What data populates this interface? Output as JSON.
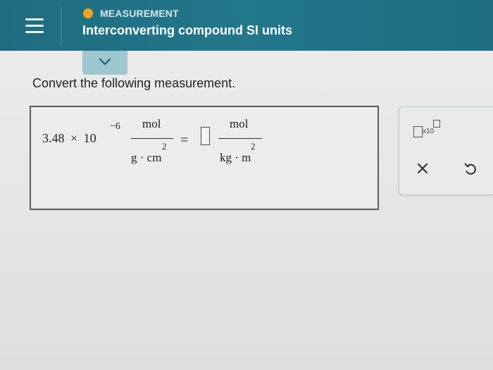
{
  "header": {
    "topic": "MEASUREMENT",
    "title": "Interconverting compound SI units",
    "status_color": "#f3a21c",
    "bar_color": "#22778b"
  },
  "question": {
    "prompt": "Convert the following measurement.",
    "coefficient": "3.48",
    "times": "×",
    "base": "10",
    "exponent": "−6",
    "from_unit": {
      "numerator": "mol",
      "denominator": "g · cm",
      "power": "2"
    },
    "equals": "=",
    "answer_value": "",
    "to_unit": {
      "numerator": "mol",
      "denominator": "kg · m",
      "power": "2"
    }
  },
  "tools": {
    "sci_notation_label": "x10",
    "clear_icon": "close-icon",
    "undo_icon": "undo-icon"
  }
}
